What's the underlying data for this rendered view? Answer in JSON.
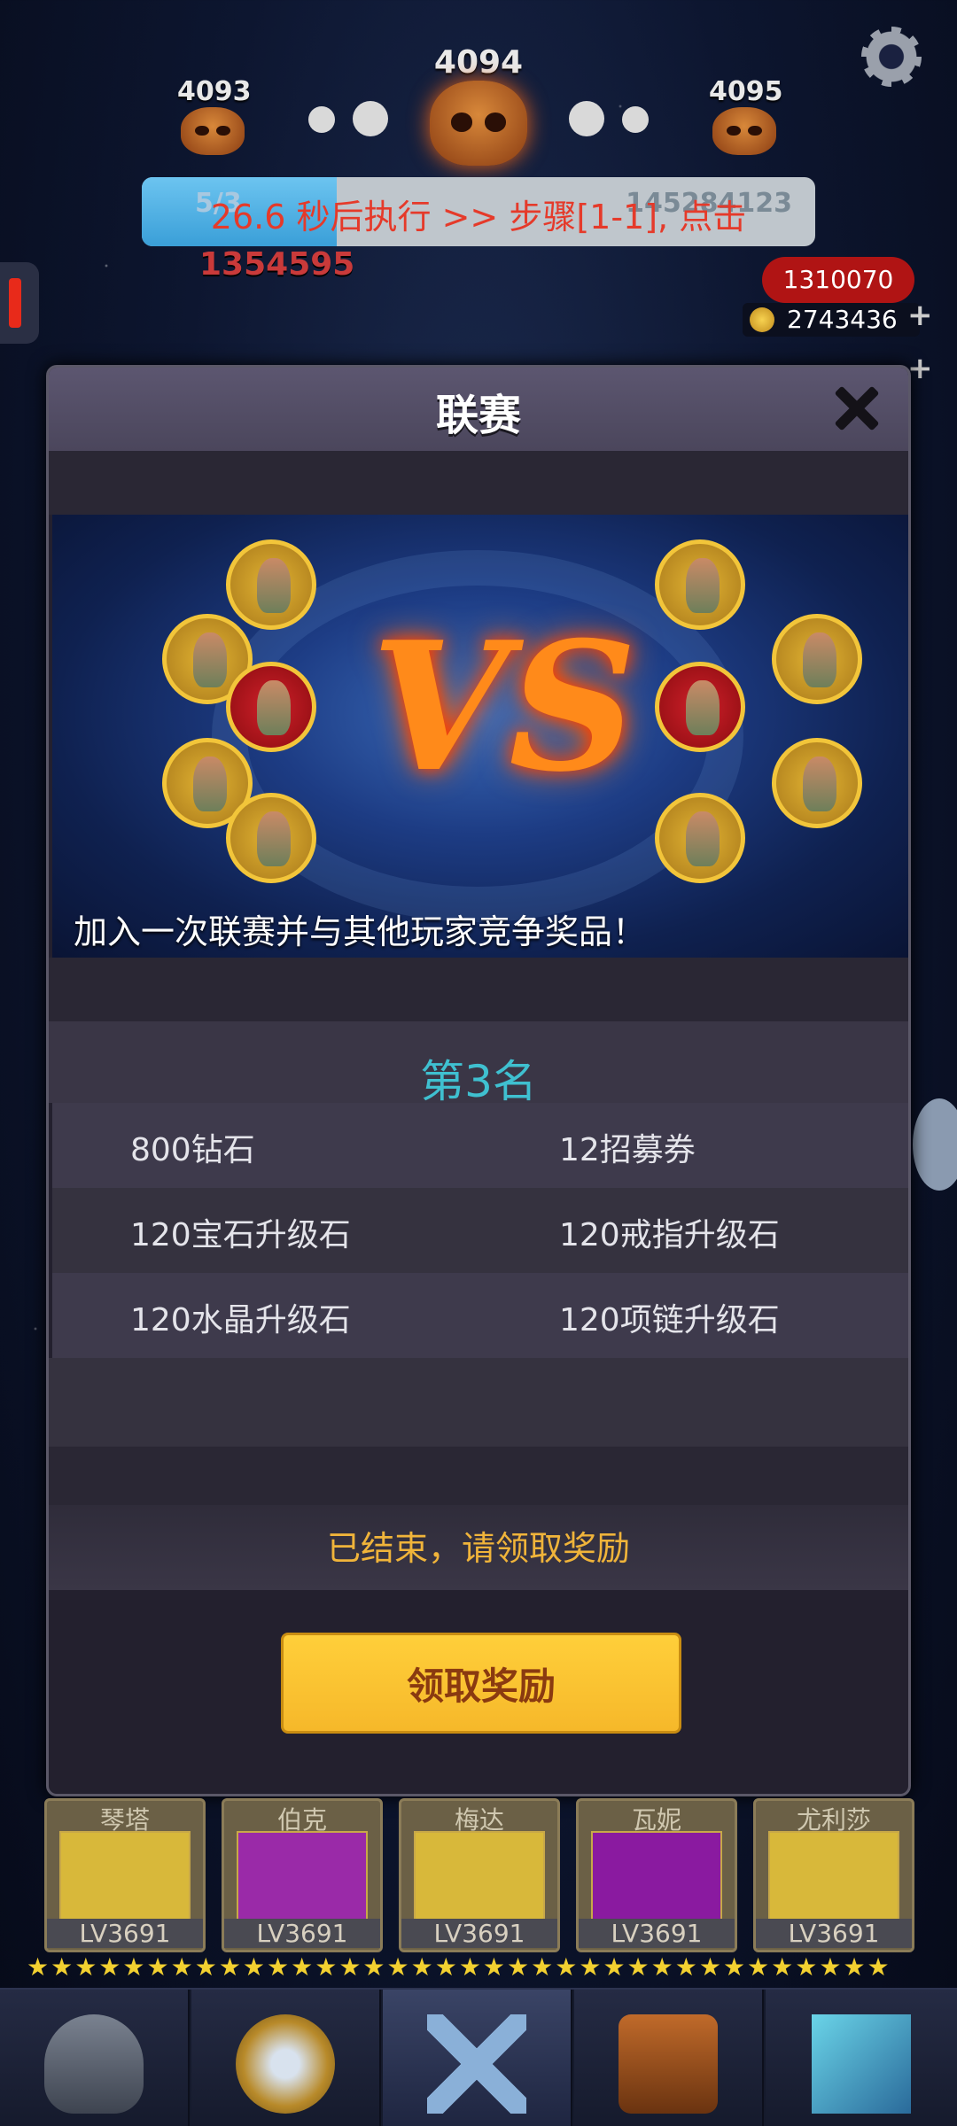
{
  "hud": {
    "stages": {
      "left": "4093",
      "center": "4094",
      "right": "4095"
    },
    "progress": {
      "fraction": 0.29,
      "left_text": "5/3",
      "right_text": "145284123"
    },
    "exec_text": "26.6 秒后执行 >> 步骤[1-1], 点击",
    "left_score": "1354595",
    "red_value": "1310070",
    "gold_value": "2743436",
    "plus": "+"
  },
  "modal": {
    "title": "联赛",
    "banner_text": "加入一次联赛并与其他玩家竞争奖品！",
    "vs_text": "VS",
    "rank_label": "第3名",
    "rewards": [
      [
        "800钻石",
        "12招募券"
      ],
      [
        "120宝石升级石",
        "120戒指升级石"
      ],
      [
        "120水晶升级石",
        "120项链升级石"
      ]
    ],
    "status_text": "已结束，请领取奖励",
    "claim_label": "领取奖励"
  },
  "roster": [
    {
      "name": "琴塔",
      "level": "LV3691",
      "color": "#d8b83a"
    },
    {
      "name": "伯克",
      "level": "LV3691",
      "color": "#9a2aa8"
    },
    {
      "name": "梅达",
      "level": "LV3691",
      "color": "#d8b83a"
    },
    {
      "name": "瓦妮",
      "level": "LV3691",
      "color": "#8a1aa0"
    },
    {
      "name": "尤利莎",
      "level": "LV3691",
      "color": "#d8b83a"
    }
  ],
  "nav": [
    {
      "icon": "helmet-icon",
      "active": false
    },
    {
      "icon": "shield-icon",
      "active": false
    },
    {
      "icon": "crossed-swords-icon",
      "active": true
    },
    {
      "icon": "treasure-chest-icon",
      "active": false
    },
    {
      "icon": "cube-icon",
      "active": false
    }
  ],
  "colors": {
    "accent": "#f6b82a",
    "rank": "#3fc0d0",
    "status": "#f0b43a",
    "exec": "#e53a2a"
  }
}
